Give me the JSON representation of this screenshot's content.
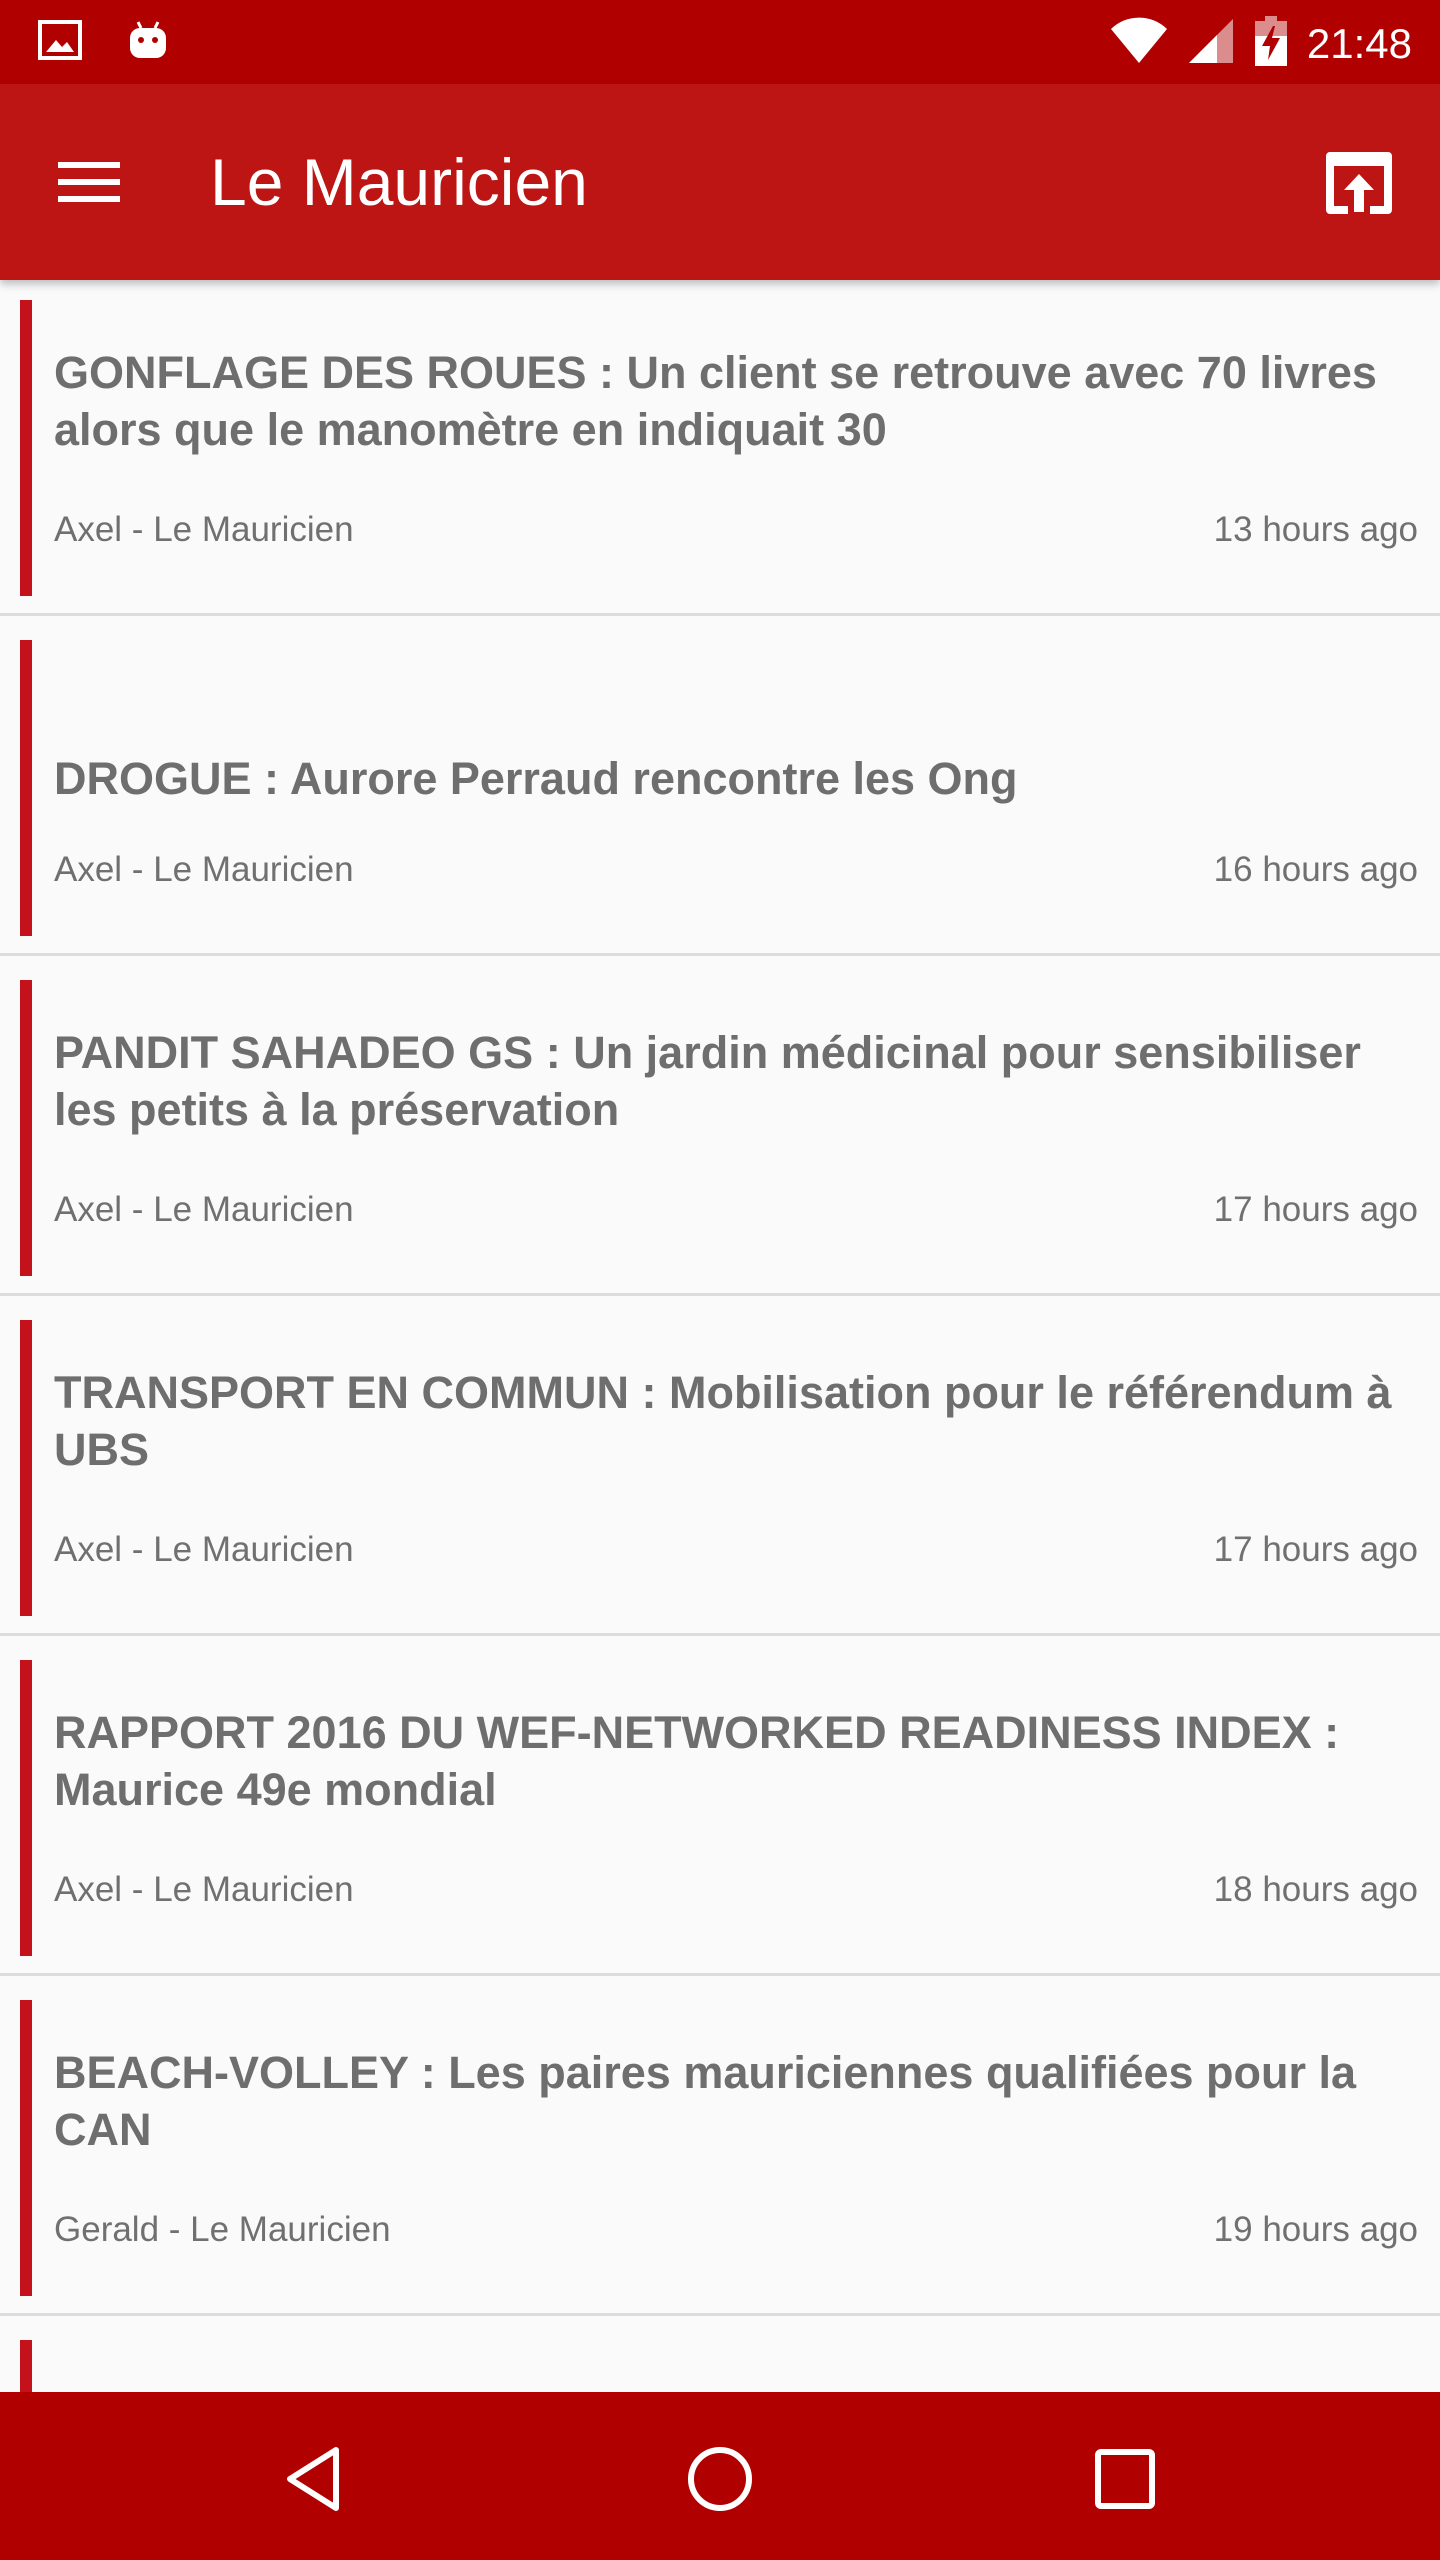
{
  "status_bar": {
    "time": "21:48",
    "left_icons": [
      "image-icon",
      "android-debug-icon"
    ],
    "right_icons": [
      "wifi-icon",
      "cell-signal-icon",
      "battery-charging-icon"
    ]
  },
  "app_bar": {
    "title": "Le Mauricien",
    "menu_icon": "menu-icon",
    "action_icon": "open-in-browser-icon"
  },
  "articles": [
    {
      "title": "GONFLAGE DES ROUES : Un client se retrouve avec 70 livres alors que le manomètre en indiquait 30",
      "author": "Axel - Le Mauricien",
      "time": "13 hours ago"
    },
    {
      "title": "DROGUE : Aurore Perraud rencontre les Ong",
      "author": "Axel - Le Mauricien",
      "time": "16 hours ago"
    },
    {
      "title": "PANDIT SAHADEO GS : Un jardin médicinal pour sensibiliser les petits à la préservation",
      "author": "Axel - Le Mauricien",
      "time": "17 hours ago"
    },
    {
      "title": "TRANSPORT EN COMMUN : Mobilisation pour le référendum à UBS",
      "author": "Axel - Le Mauricien",
      "time": "17 hours ago"
    },
    {
      "title": "RAPPORT 2016 DU WEF-NETWORKED READINESS INDEX : Maurice 49e mondial",
      "author": "Axel - Le Mauricien",
      "time": "18 hours ago"
    },
    {
      "title": "BEACH-VOLLEY : Les paires mauriciennes qualifiées pour la CAN",
      "author": "Gerald - Le Mauricien",
      "time": "19 hours ago"
    }
  ],
  "nav_bar": {
    "icons": [
      "back-icon",
      "home-icon",
      "recents-icon"
    ]
  },
  "colors": {
    "status_bar": "#b00000",
    "app_bar": "#bd1414",
    "accent_bar": "#c4121c",
    "card_background": "#fafafa"
  }
}
